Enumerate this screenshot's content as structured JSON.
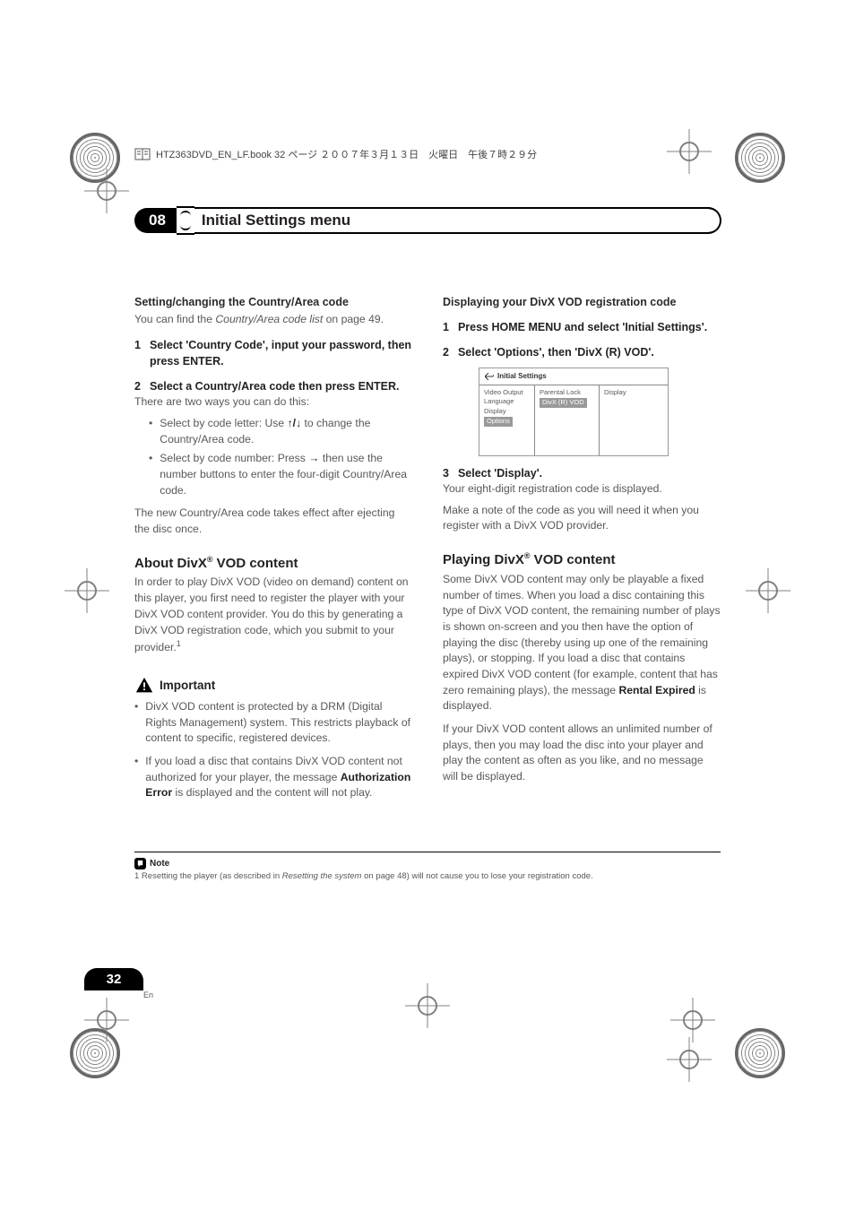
{
  "header": {
    "bookfile": "HTZ363DVD_EN_LF.book  32 ページ  ２００７年３月１３日　火曜日　午後７時２９分"
  },
  "chapter": {
    "number": "08",
    "title": "Initial Settings menu"
  },
  "left": {
    "sec1_title": "Setting/changing the Country/Area code",
    "sec1_body_a": "You can find the ",
    "sec1_body_italic": "Country/Area code list",
    "sec1_body_b": " on page 49.",
    "step1_num": "1",
    "step1_text": "Select 'Country Code', input your password, then press ENTER.",
    "step2_num": "2",
    "step2_text": "Select a Country/Area code then press ENTER.",
    "step2_after": "There are two ways you can do this:",
    "bullet1_a": "Select by code letter: Use ",
    "bullet1_arrows": "↑/↓",
    "bullet1_b": " to change the Country/Area code.",
    "bullet2_a": "Select by code number: Press ",
    "bullet2_arrow": "→",
    "bullet2_b": " then use the number buttons to enter the four-digit Country/Area code.",
    "after_bullets": "The new Country/Area code takes effect after ejecting the disc once.",
    "h2_a": "About DivX",
    "h2_reg": "®",
    "h2_b": " VOD content",
    "about_body": "In order to play DivX VOD (video on demand) content on this player, you first need to register the player with your DivX VOD content provider. You do this by generating a DivX VOD registration code, which you submit to your provider.",
    "about_footref": "1",
    "important_label": "Important",
    "imp1": "DivX VOD content is protected by a DRM (Digital Rights Management) system. This restricts playback of content to specific, registered devices.",
    "imp2_a": "If you load a disc that contains DivX VOD content not authorized for your player, the message ",
    "imp2_bold": "Authorization Error",
    "imp2_b": " is displayed and the content will not play."
  },
  "right": {
    "sec_title": "Displaying your DivX VOD registration code",
    "step1_num": "1",
    "step1_text": "Press HOME MENU and select 'Initial Settings'.",
    "step2_num": "2",
    "step2_text": "Select 'Options', then 'DivX (R) VOD'.",
    "screenshot": {
      "title": "Initial Settings",
      "left_items": [
        "Video Output",
        "Language",
        "Display",
        "Options"
      ],
      "left_selected_index": 3,
      "mid_items": [
        "Parental Lock",
        "DivX (R) VOD"
      ],
      "mid_selected_index": 1,
      "right_items": [
        "Display"
      ]
    },
    "step3_num": "3",
    "step3_text": "Select 'Display'.",
    "step3_after": "Your eight-digit registration code is displayed.",
    "step3_after2": "Make a note of the code as you will need it when you register with a DivX VOD provider.",
    "h2_a": "Playing DivX",
    "h2_reg": "®",
    "h2_b": " VOD content",
    "play_body_a": "Some DivX VOD content may only be playable a fixed number of times. When you load a disc containing this type of DivX VOD content, the remaining number of plays is shown on-screen and you then have the option of playing the disc (thereby using up one of the remaining plays), or stopping. If you load a disc that contains expired DivX VOD content (for example, content that has zero remaining plays), the message ",
    "play_body_bold": "Rental Expired",
    "play_body_b": " is displayed.",
    "play_body2": "If your DivX VOD content allows an unlimited number of plays, then you may load the disc into your player and play the content as often as you like, and no message will be displayed."
  },
  "footer": {
    "note_label": "Note",
    "footnote_a": "1 Resetting the player (as described in ",
    "footnote_italic": "Resetting the system",
    "footnote_b": " on page 48) will not cause you to lose your registration code.",
    "page_number": "32",
    "lang": "En"
  }
}
